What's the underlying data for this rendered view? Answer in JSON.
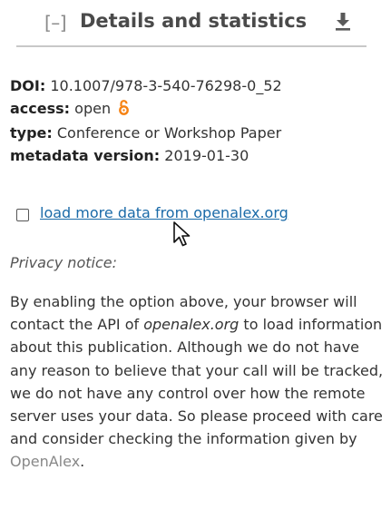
{
  "header": {
    "collapse_label": "[–]",
    "title": "Details and statistics",
    "download_icon": "download-icon"
  },
  "metadata": {
    "doi_key": "DOI:",
    "doi_value": "10.1007/978-3-540-76298-0_52",
    "access_key": "access:",
    "access_value": "open",
    "access_icon": "open-access-icon",
    "type_key": "type:",
    "type_value": "Conference or Workshop Paper",
    "version_key": "metadata version:",
    "version_value": "2019-01-30"
  },
  "load_more": {
    "label": "load more data from openalex.org",
    "checked": false
  },
  "privacy": {
    "heading": "Privacy notice:",
    "part1": "By enabling the option above, your browser will contact the API of ",
    "site": "openalex.org",
    "part2": " to load information about this publication. Although we do not have any reason to believe that your call will be tracked, we do not have any control over how the remote server uses your data. So please proceed with care and consider checking the information given by ",
    "provider": "OpenAlex",
    "part3": "."
  },
  "colors": {
    "link": "#1a6aa8",
    "open_access": "#f68212",
    "divider": "#c8c8c8"
  }
}
